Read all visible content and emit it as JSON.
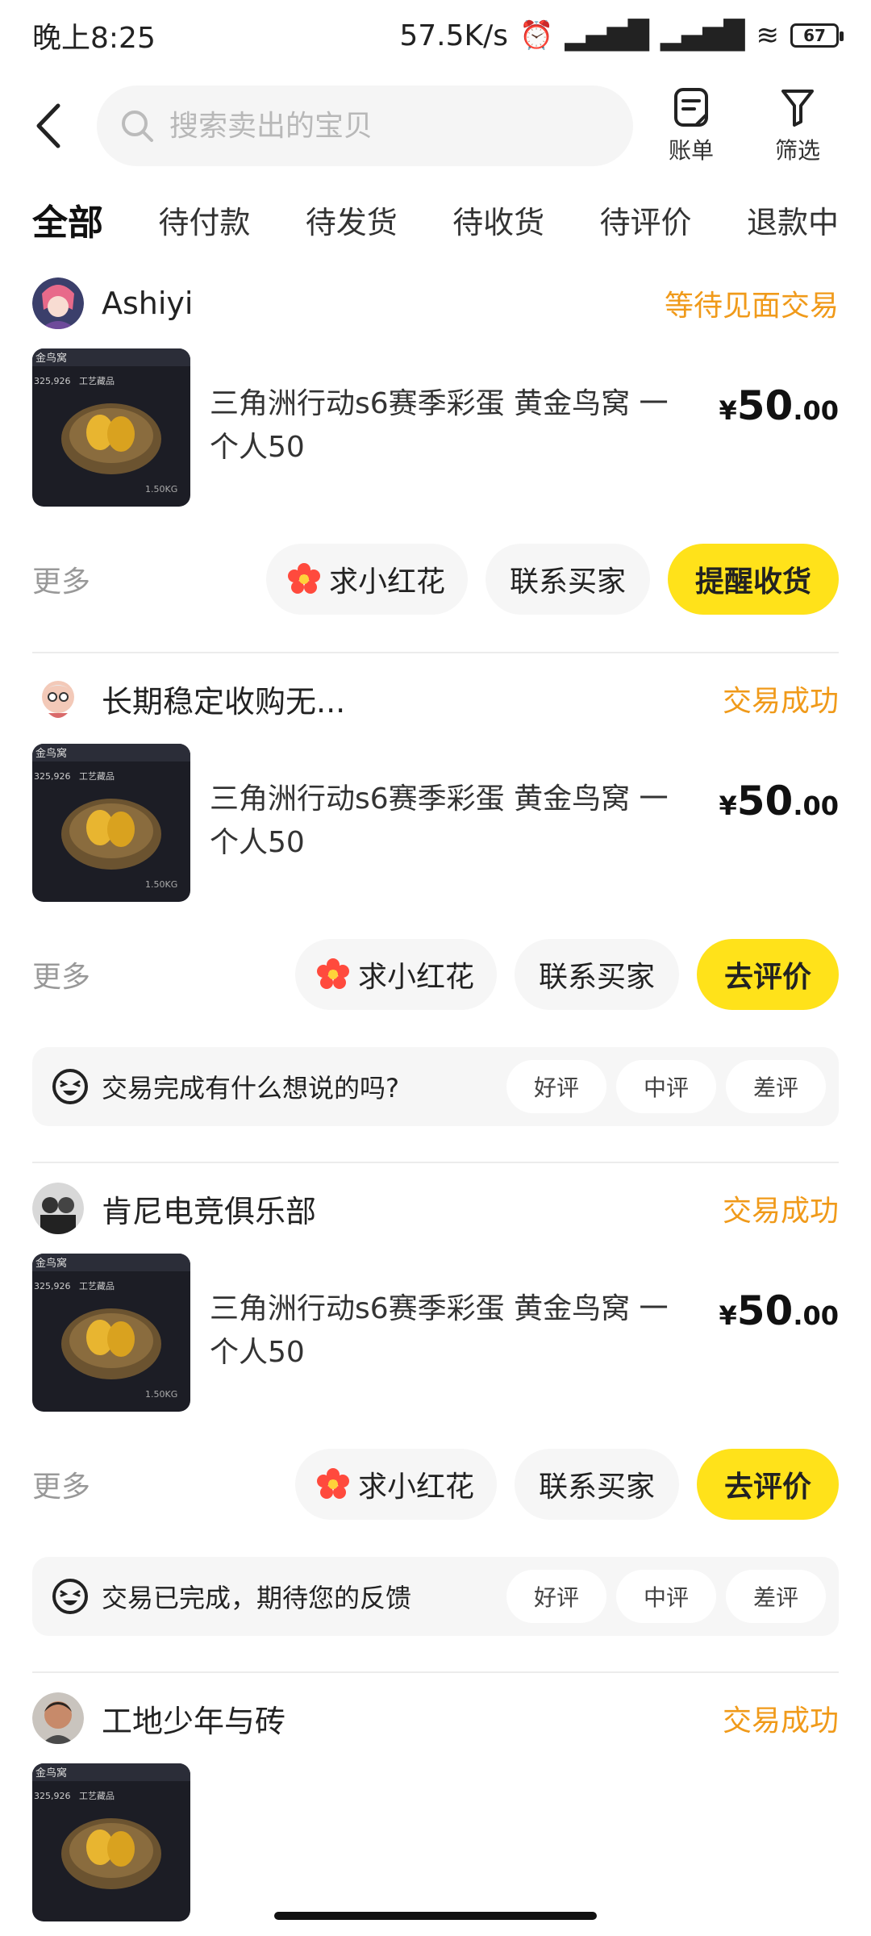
{
  "status_bar": {
    "time": "晚上8:25",
    "network_speed": "57.5K/s",
    "battery": "67"
  },
  "header": {
    "search_placeholder": "搜索卖出的宝贝",
    "bill_label": "账单",
    "filter_label": "筛选"
  },
  "tabs": [
    {
      "label": "全部",
      "active": true
    },
    {
      "label": "待付款"
    },
    {
      "label": "待发货"
    },
    {
      "label": "待收货"
    },
    {
      "label": "待评价"
    },
    {
      "label": "退款中"
    }
  ],
  "orders": [
    {
      "seller": "Ashiyi",
      "status": "等待见面交易",
      "title": "三角洲行动s6赛季彩蛋 黄金鸟窝 一个人50",
      "price_symbol": "¥",
      "price_int": "50",
      "price_dec": ".00",
      "more": "更多",
      "btn_flower": "求小红花",
      "btn_contact": "联系买家",
      "btn_primary": "提醒收货"
    },
    {
      "seller": "长期稳定收购无...",
      "status": "交易成功",
      "title": "三角洲行动s6赛季彩蛋 黄金鸟窝 一个人50",
      "price_symbol": "¥",
      "price_int": "50",
      "price_dec": ".00",
      "more": "更多",
      "btn_flower": "求小红花",
      "btn_contact": "联系买家",
      "btn_primary": "去评价",
      "feedback_text": "交易完成有什么想说的吗?",
      "rating_good": "好评",
      "rating_mid": "中评",
      "rating_bad": "差评"
    },
    {
      "seller": "肯尼电竞俱乐部",
      "status": "交易成功",
      "title": "三角洲行动s6赛季彩蛋 黄金鸟窝 一个人50",
      "price_symbol": "¥",
      "price_int": "50",
      "price_dec": ".00",
      "more": "更多",
      "btn_flower": "求小红花",
      "btn_contact": "联系买家",
      "btn_primary": "去评价",
      "feedback_text": "交易已完成，期待您的反馈",
      "rating_good": "好评",
      "rating_mid": "中评",
      "rating_bad": "差评"
    },
    {
      "seller": "工地少年与砖",
      "status": "交易成功"
    }
  ],
  "thumb_labels": {
    "top": "金鸟窝",
    "id": "325,926",
    "tag": "工艺藏品",
    "weight": "1.50KG"
  },
  "colors": {
    "accent_yellow": "#ffe21a",
    "status_orange": "#f09a1a",
    "flower_red": "#ff4a3d",
    "muted_gray": "#999999"
  }
}
